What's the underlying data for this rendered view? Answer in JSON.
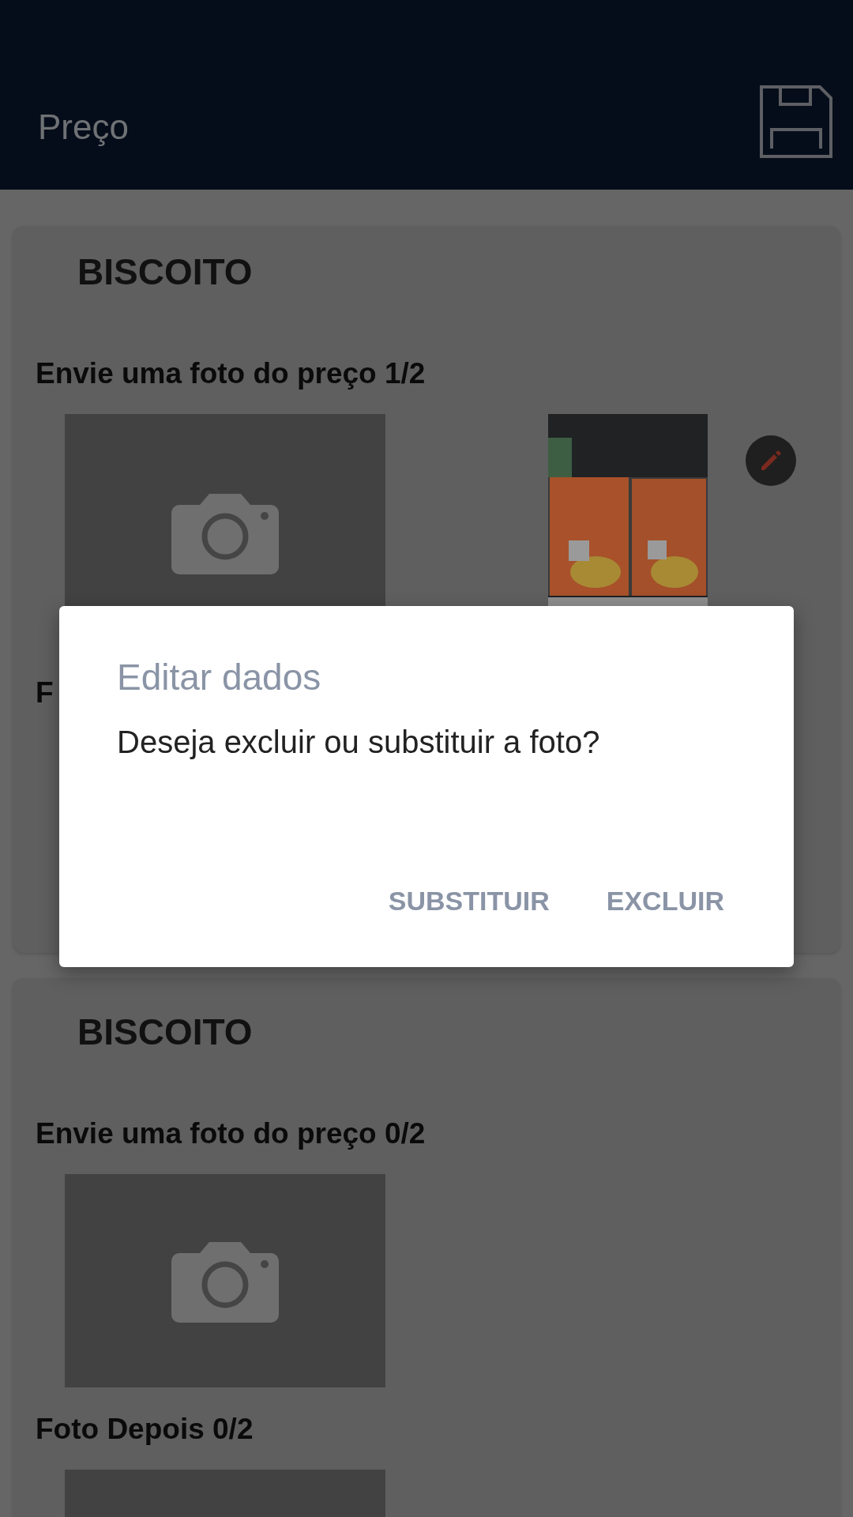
{
  "app_bar": {
    "title": "Preço"
  },
  "cards": [
    {
      "title": "BISCOITO",
      "sections": [
        {
          "label": "Envie uma foto do preço 1/2",
          "photos": [
            {
              "kind": "empty"
            },
            {
              "kind": "picture",
              "editable": true
            }
          ]
        },
        {
          "label": "F"
        }
      ]
    },
    {
      "title": "BISCOITO",
      "sections": [
        {
          "label": "Envie uma foto do preço 0/2",
          "photos": [
            {
              "kind": "empty"
            }
          ]
        },
        {
          "label": "Foto Depois 0/2",
          "photos": [
            {
              "kind": "empty"
            }
          ]
        }
      ]
    }
  ],
  "dialog": {
    "title": "Editar dados",
    "message": "Deseja excluir ou substituir a foto?",
    "buttons": [
      "SUBSTITUIR",
      "EXCLUIR"
    ]
  }
}
